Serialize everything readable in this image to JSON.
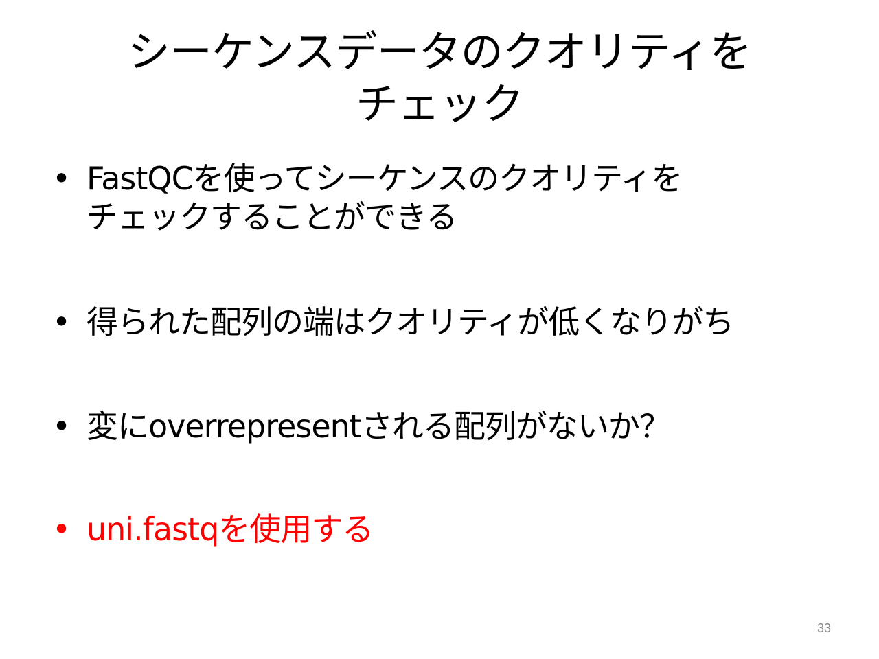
{
  "slide": {
    "title_lines": [
      "シーケンスデータのクオリティを",
      "チェック"
    ],
    "bullets": [
      {
        "marker": "•",
        "lines": [
          "FastQCを使ってシーケンスのクオリティを",
          "チェックすることができる"
        ]
      },
      {
        "marker": "•",
        "lines": [
          "得られた配列の端はクオリティが低くなりがち"
        ]
      },
      {
        "marker": "•",
        "lines": [
          "変にoverrepresentされる配列がないか？"
        ]
      },
      {
        "marker": "•",
        "lines": [
          "uni.fastqを使用する"
        ],
        "color": "#ff0000"
      }
    ],
    "page_number": "33"
  },
  "colors": {
    "text": "#000000",
    "highlight": "#ff0000",
    "page_number": "#8a8a8a",
    "background": "#ffffff"
  }
}
